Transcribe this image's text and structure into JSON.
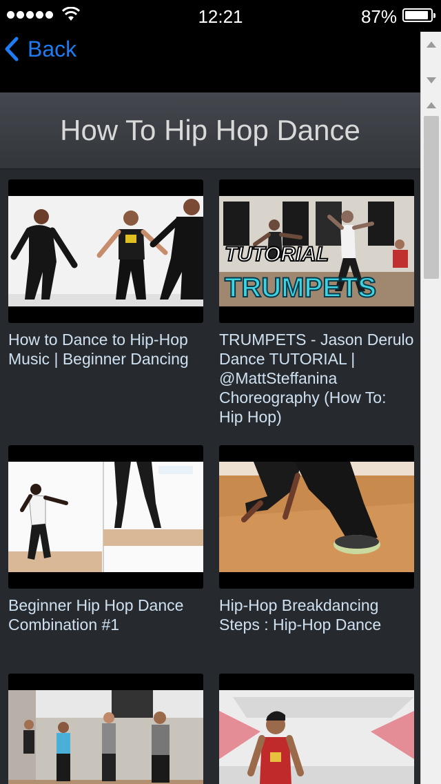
{
  "status_bar": {
    "time": "12:21",
    "battery_percent": "87%",
    "signal_bars": 5
  },
  "nav": {
    "back_label": "Back"
  },
  "page": {
    "title": "How To Hip Hop Dance"
  },
  "videos": [
    {
      "title": "How to Dance to Hip-Hop Music | Beginner Dancing"
    },
    {
      "title": "TRUMPETS - Jason Derulo Dance TUTORIAL | @MattSteffanina Choreography (How To: Hip Hop)"
    },
    {
      "title": "Beginner Hip Hop Dance Combination #1"
    },
    {
      "title": "Hip-Hop Breakdancing Steps : Hip-Hop Dance"
    },
    {
      "title": ""
    },
    {
      "title": ""
    }
  ],
  "thumbnail_text": {
    "video2_line1": "TUTORIAL",
    "video2_line2": "TRUMPETS"
  },
  "colors": {
    "accent_blue": "#1e7bf2",
    "content_bg": "#262a2f",
    "title_text": "#cfe0f0"
  }
}
